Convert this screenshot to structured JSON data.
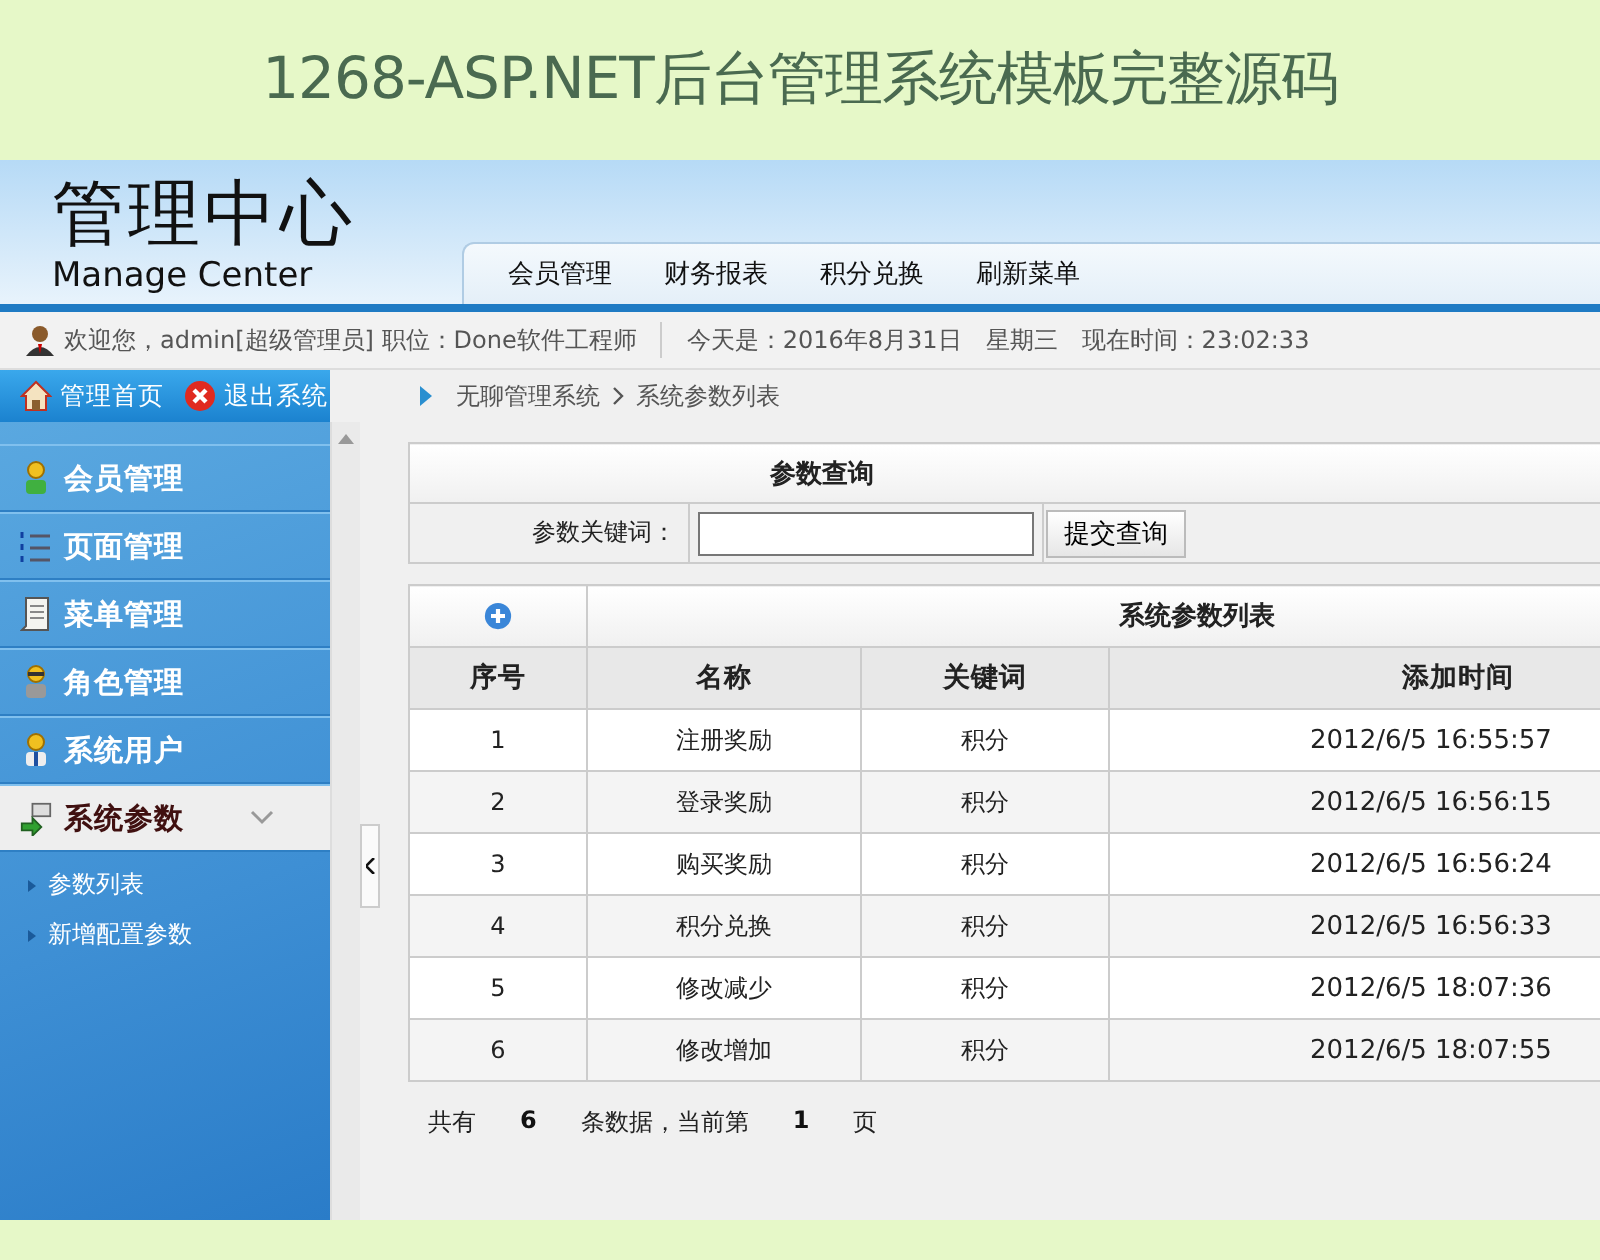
{
  "banner": {
    "title": "1268-ASP.NET后台管理系统模板完整源码"
  },
  "header": {
    "logo_title": "管理中心",
    "logo_subtitle": "Manage Center",
    "nav": [
      "会员管理",
      "财务报表",
      "积分兑换",
      "刷新菜单"
    ]
  },
  "info_bar": {
    "welcome": "欢迎您，admin[超级管理员] 职位：Done软件工程师",
    "today": "今天是：2016年8月31日　星期三　现在时间：23:02:33"
  },
  "sidebar": {
    "home": "管理首页",
    "logout": "退出系统",
    "items": [
      {
        "label": "会员管理",
        "selected": false
      },
      {
        "label": "页面管理",
        "selected": false
      },
      {
        "label": "菜单管理",
        "selected": false
      },
      {
        "label": "角色管理",
        "selected": false
      },
      {
        "label": "系统用户",
        "selected": false
      },
      {
        "label": "系统参数",
        "selected": true,
        "expanded": true,
        "children": [
          "参数列表",
          "新增配置参数"
        ]
      }
    ]
  },
  "breadcrumb": [
    "无聊管理系统",
    "系统参数列表"
  ],
  "search": {
    "title": "参数查询",
    "label": "参数关键词：",
    "button": "提交查询"
  },
  "table": {
    "title": "系统参数列表",
    "columns": [
      "序号",
      "名称",
      "关键词",
      "添加时间"
    ],
    "rows": [
      [
        "1",
        "注册奖励",
        "积分",
        "2012/6/5 16:55:57"
      ],
      [
        "2",
        "登录奖励",
        "积分",
        "2012/6/5 16:56:15"
      ],
      [
        "3",
        "购买奖励",
        "积分",
        "2012/6/5 16:56:24"
      ],
      [
        "4",
        "积分兑换",
        "积分",
        "2012/6/5 16:56:33"
      ],
      [
        "5",
        "修改减少",
        "积分",
        "2012/6/5 18:07:36"
      ],
      [
        "6",
        "修改增加",
        "积分",
        "2012/6/5 18:07:55"
      ]
    ]
  },
  "pager": {
    "prefix": "共有",
    "total": "6",
    "middle": "条数据，当前第",
    "page": "1",
    "suffix": "页"
  }
}
